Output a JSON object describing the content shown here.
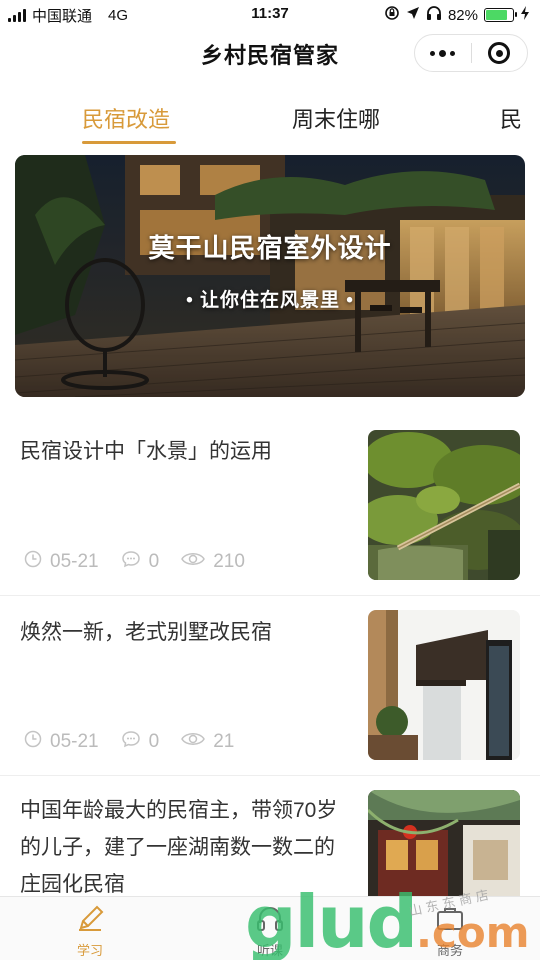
{
  "status_bar": {
    "carrier": "中国联通",
    "network": "4G",
    "time": "11:37",
    "battery": "82%",
    "battery_level": 0.82
  },
  "nav": {
    "title": "乡村民宿管家"
  },
  "tabs": [
    {
      "label": "民宿改造",
      "active": true
    },
    {
      "label": "周末住哪",
      "active": false
    },
    {
      "label": "民",
      "active": false
    }
  ],
  "banner": {
    "title": "莫干山民宿室外设计",
    "subtitle": "• 让你住在风景里 •"
  },
  "articles": [
    {
      "title": "民宿设计中「水景」的运用",
      "date": "05-21",
      "comments": "0",
      "views": "210"
    },
    {
      "title": "焕然一新，老式别墅改民宿",
      "date": "05-21",
      "comments": "0",
      "views": "21"
    },
    {
      "title": "中国年龄最大的民宿主，带领70岁的儿子，建了一座湖南数一数二的庄园化民宿"
    }
  ],
  "tabbar": [
    {
      "label": "学习",
      "icon": "pencil-icon",
      "active": true
    },
    {
      "label": "听课",
      "icon": "headphones-icon",
      "active": false
    },
    {
      "label": "商务",
      "icon": "briefcase-icon",
      "active": false
    }
  ],
  "watermark": {
    "text": "glud",
    "suffix": ".com",
    "small": "山东东商店"
  },
  "colors": {
    "accent": "#d89a3a",
    "meta_gray": "#bbbbbb",
    "title_text": "#333333"
  }
}
